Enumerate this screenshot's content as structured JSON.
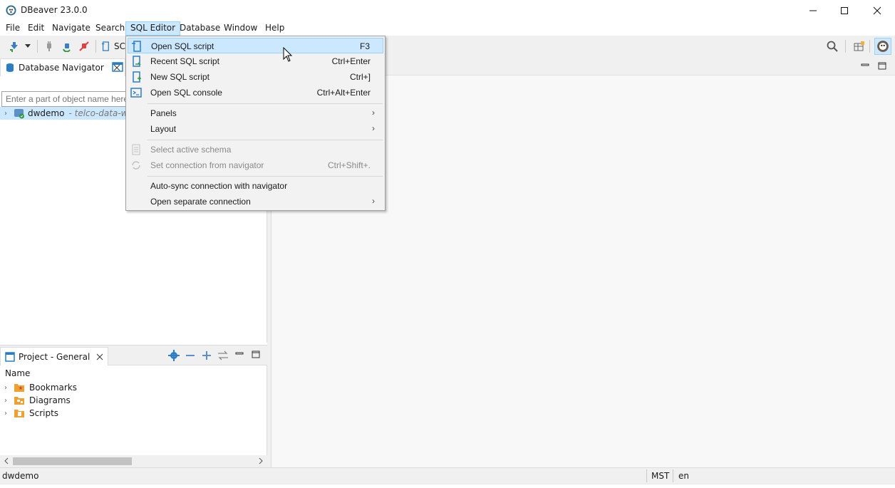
{
  "window": {
    "title": "DBeaver 23.0.0"
  },
  "menubar": {
    "items": [
      "File",
      "Edit",
      "Navigate",
      "Search",
      "SQL Editor",
      "Database",
      "Window",
      "Help"
    ]
  },
  "toolbar": {
    "sql_button_label": "SC"
  },
  "navigator": {
    "tab_label": "Database Navigator",
    "filter_placeholder": "Enter a part of object name here",
    "connection": {
      "name": "dwdemo",
      "description": "- telco-data-wa"
    }
  },
  "project": {
    "tab_label": "Project - General",
    "column_header": "Name",
    "items": [
      "Bookmarks",
      "Diagrams",
      "Scripts"
    ]
  },
  "status": {
    "connection": "dwdemo",
    "timezone": "MST",
    "locale": "en"
  },
  "sql_menu": {
    "items": [
      {
        "label": "Open SQL script",
        "shortcut": "F3"
      },
      {
        "label": "Recent SQL script",
        "shortcut": "Ctrl+Enter"
      },
      {
        "label": "New SQL script",
        "shortcut": "Ctrl+]"
      },
      {
        "label": "Open SQL console",
        "shortcut": "Ctrl+Alt+Enter"
      },
      {
        "label": "Panels"
      },
      {
        "label": "Layout"
      },
      {
        "label": "Select active schema"
      },
      {
        "label": "Set connection from navigator",
        "shortcut": "Ctrl+Shift+."
      },
      {
        "label": "Auto-sync connection with navigator"
      },
      {
        "label": "Open separate connection"
      }
    ]
  },
  "colors": {
    "selection": "#cce8ff",
    "selection_border": "#99d1ff",
    "toolbar_bg": "#f0f0f0"
  }
}
